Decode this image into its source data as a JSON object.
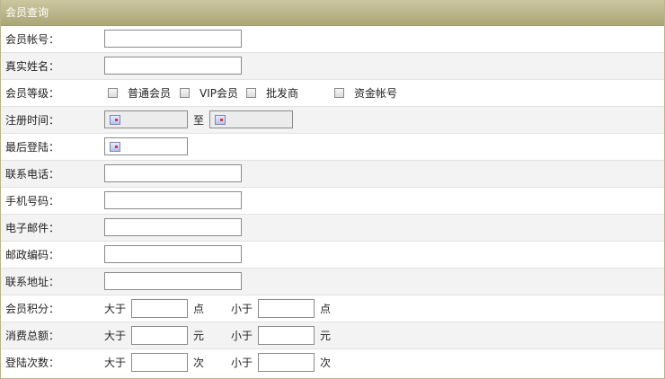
{
  "header": {
    "title": "会员查询"
  },
  "fields": {
    "account": {
      "label": "会员帐号：",
      "value": ""
    },
    "realname": {
      "label": "真实姓名：",
      "value": ""
    },
    "level": {
      "label": "会员等级：",
      "options": [
        "普通会员",
        "VIP会员",
        "批发商",
        "资金帐号"
      ]
    },
    "register_time": {
      "label": "注册时间：",
      "to": "至"
    },
    "last_login": {
      "label": "最后登陆："
    },
    "phone": {
      "label": "联系电话：",
      "value": ""
    },
    "mobile": {
      "label": "手机号码：",
      "value": ""
    },
    "email": {
      "label": "电子邮件：",
      "value": ""
    },
    "postcode": {
      "label": "邮政编码：",
      "value": ""
    },
    "address": {
      "label": "联系地址：",
      "value": ""
    },
    "points": {
      "label": "会员积分：",
      "gt": "大于",
      "lt": "小于",
      "unit": "点"
    },
    "spend": {
      "label": "消费总额：",
      "gt": "大于",
      "lt": "小于",
      "unit": "元"
    },
    "logins": {
      "label": "登陆次数：",
      "gt": "大于",
      "lt": "小于",
      "unit": "次"
    }
  }
}
